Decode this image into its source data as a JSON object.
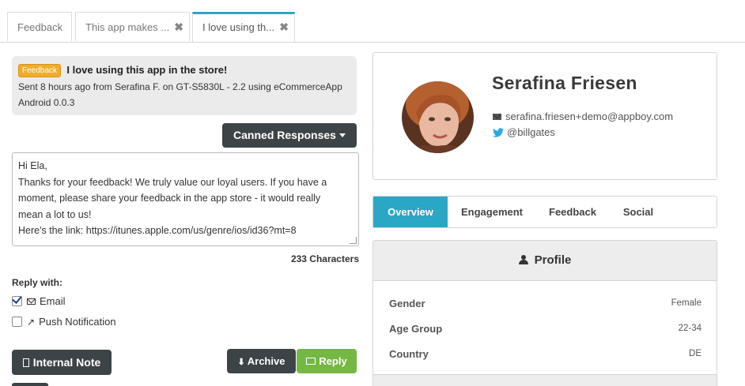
{
  "tabs": [
    {
      "label": "Feedback",
      "closable": false
    },
    {
      "label": "This app makes ...",
      "closable": true
    },
    {
      "label": "I love using th...",
      "closable": true,
      "active": true
    }
  ],
  "message": {
    "badge": "Feedback",
    "title": "I love using this app in the store!",
    "meta_line1": "Sent 8 hours ago from Serafina F. on GT-S5830L - 2.2 using eCommerceApp",
    "meta_line2": "Android 0.0.3"
  },
  "canned_label": "Canned Responses",
  "reply_lines": [
    "Hi Ela,",
    "Thanks for your feedback! We truly value our loyal users. If you have a",
    "moment, please share your feedback in the app store - it would really",
    "mean a lot to us!",
    "Here's the link: https://itunes.apple.com/us/genre/ios/id36?mt=8"
  ],
  "char_count": "233 Characters",
  "reply_with": {
    "label": "Reply with:",
    "email": "Email",
    "push": "Push Notification"
  },
  "buttons": {
    "internal_note": "Internal Note",
    "archive": "Archive",
    "reply": "Reply"
  },
  "profile": {
    "name": "Serafina Friesen",
    "email": "serafina.friesen+demo@appboy.com",
    "twitter": "@billgates"
  },
  "profile_tabs": [
    "Overview",
    "Engagement",
    "Feedback",
    "Social"
  ],
  "details": {
    "heading": "Profile",
    "rows": [
      {
        "key": "Gender",
        "value": "Female"
      },
      {
        "key": "Age Group",
        "value": "22-34"
      },
      {
        "key": "Country",
        "value": "DE"
      }
    ]
  },
  "colors": {
    "accent": "#2aa7c4",
    "badge": "#f0ad2c",
    "reply": "#74b743",
    "dark_button": "#3d4448"
  },
  "icons": [
    "close-icon",
    "caret-down-icon",
    "envelope-icon",
    "share-icon",
    "file-icon",
    "download-icon",
    "twitter-icon",
    "user-icon"
  ]
}
